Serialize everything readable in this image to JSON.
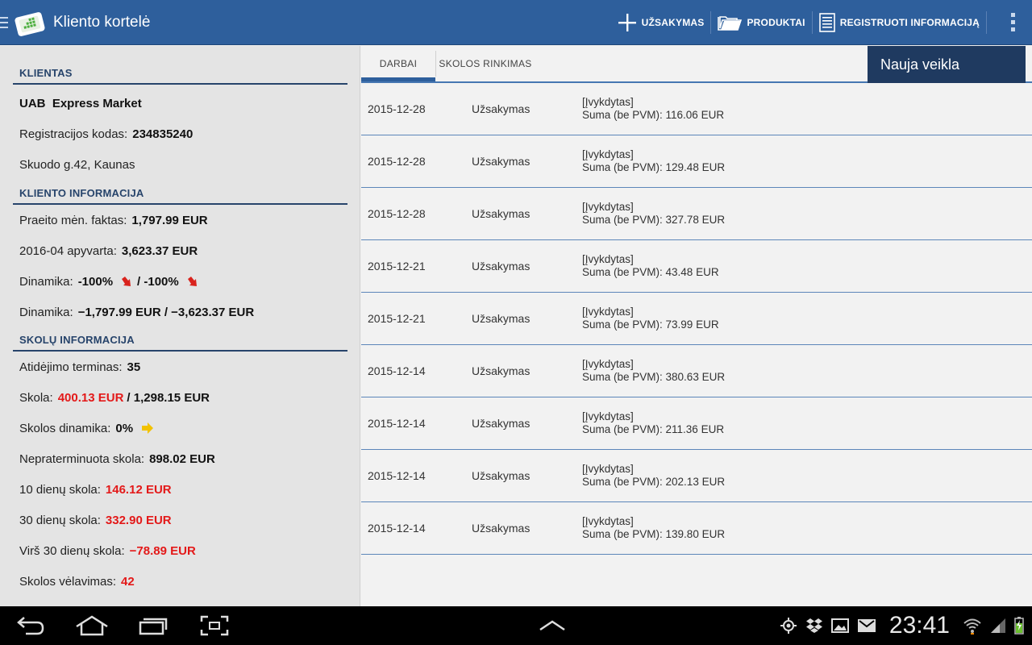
{
  "app": {
    "title": "Kliento kortelė"
  },
  "toolbar": {
    "order_label": "UŽSAKYMAS",
    "products_label": "PRODUKTAI",
    "register_label": "REGISTRUOTI INFORMACIJĄ"
  },
  "client": {
    "section_title": "KLIENTAS",
    "name": "UAB  Express Market",
    "reg_code_label": "Registracijos kodas:",
    "reg_code_value": "234835240",
    "address": "Skuodo g.42, Kaunas"
  },
  "client_info": {
    "section_title": "KLIENTO INFORMACIJA",
    "last_month_label": "Praeito mėn. faktas:",
    "last_month_value": "1,797.99 EUR",
    "turnover_label": "2016-04 apyvarta:",
    "turnover_value": "3,623.37 EUR",
    "dynamics_pct_label": "Dinamika:",
    "dynamics_pct_value_1": "-100%",
    "dynamics_pct_value_2": "/ -100%",
    "dynamics_amt_label": "Dinamika:",
    "dynamics_amt_value": "−1,797.99 EUR / −3,623.37 EUR"
  },
  "debt_info": {
    "section_title": "SKOLŲ INFORMACIJA",
    "grace_label": "Atidėjimo terminas:",
    "grace_value": "35",
    "debt_label": "Skola:",
    "debt_value_red": "400.13 EUR",
    "debt_value_total": "/ 1,298.15 EUR",
    "debt_dyn_label": "Skolos dinamika:",
    "debt_dyn_value": "0%",
    "unexpired_label": "Nepraterminuota skola:",
    "unexpired_value": "898.02 EUR",
    "d10_label": "10 dienų skola:",
    "d10_value": "146.12 EUR",
    "d30_label": "30 dienų skola:",
    "d30_value": "332.90 EUR",
    "over30_label": "Virš 30 dienų skola:",
    "over30_value": "−78.89 EUR",
    "delay_label": "Skolos vėlavimas:",
    "delay_value": "42"
  },
  "tabs": {
    "works": "DARBAI",
    "debt_collection": "SKOLOS RINKIMAS"
  },
  "new_activity": "Nauja veikla",
  "activities": [
    {
      "date": "2015-12-28",
      "type": "Užsakymas",
      "status": "[Įvykdytas]",
      "sum": "Suma (be PVM): 116.06 EUR"
    },
    {
      "date": "2015-12-28",
      "type": "Užsakymas",
      "status": "[Įvykdytas]",
      "sum": "Suma (be PVM): 129.48 EUR"
    },
    {
      "date": "2015-12-28",
      "type": "Užsakymas",
      "status": "[Įvykdytas]",
      "sum": "Suma (be PVM): 327.78 EUR"
    },
    {
      "date": "2015-12-21",
      "type": "Užsakymas",
      "status": "[Įvykdytas]",
      "sum": "Suma (be PVM): 43.48 EUR"
    },
    {
      "date": "2015-12-21",
      "type": "Užsakymas",
      "status": "[Įvykdytas]",
      "sum": "Suma (be PVM): 73.99 EUR"
    },
    {
      "date": "2015-12-14",
      "type": "Užsakymas",
      "status": "[Įvykdytas]",
      "sum": "Suma (be PVM): 380.63 EUR"
    },
    {
      "date": "2015-12-14",
      "type": "Užsakymas",
      "status": "[Įvykdytas]",
      "sum": "Suma (be PVM): 211.36 EUR"
    },
    {
      "date": "2015-12-14",
      "type": "Užsakymas",
      "status": "[Įvykdytas]",
      "sum": "Suma (be PVM): 202.13 EUR"
    },
    {
      "date": "2015-12-14",
      "type": "Užsakymas",
      "status": "[Įvykdytas]",
      "sum": "Suma (be PVM): 139.80 EUR"
    }
  ],
  "status_bar": {
    "clock": "23:41"
  },
  "colors": {
    "action_bar": "#2e5f9c",
    "header_text": "#27446b",
    "negative": "#e31919",
    "neutral_arrow": "#f2c200",
    "new_activity_bg": "#1f3a60"
  },
  "icons": [
    "drawer-icon",
    "app-logo-icon",
    "plus-icon",
    "folder-icon",
    "document-icon",
    "overflow-menu-icon",
    "arrow-down-red-icon",
    "arrow-right-yellow-icon",
    "back-icon",
    "home-icon",
    "recent-apps-icon",
    "screenshot-icon",
    "up-chevron-icon",
    "gps-icon",
    "dropbox-icon",
    "gallery-icon",
    "email-icon",
    "wifi-icon",
    "signal-icon",
    "battery-icon"
  ]
}
